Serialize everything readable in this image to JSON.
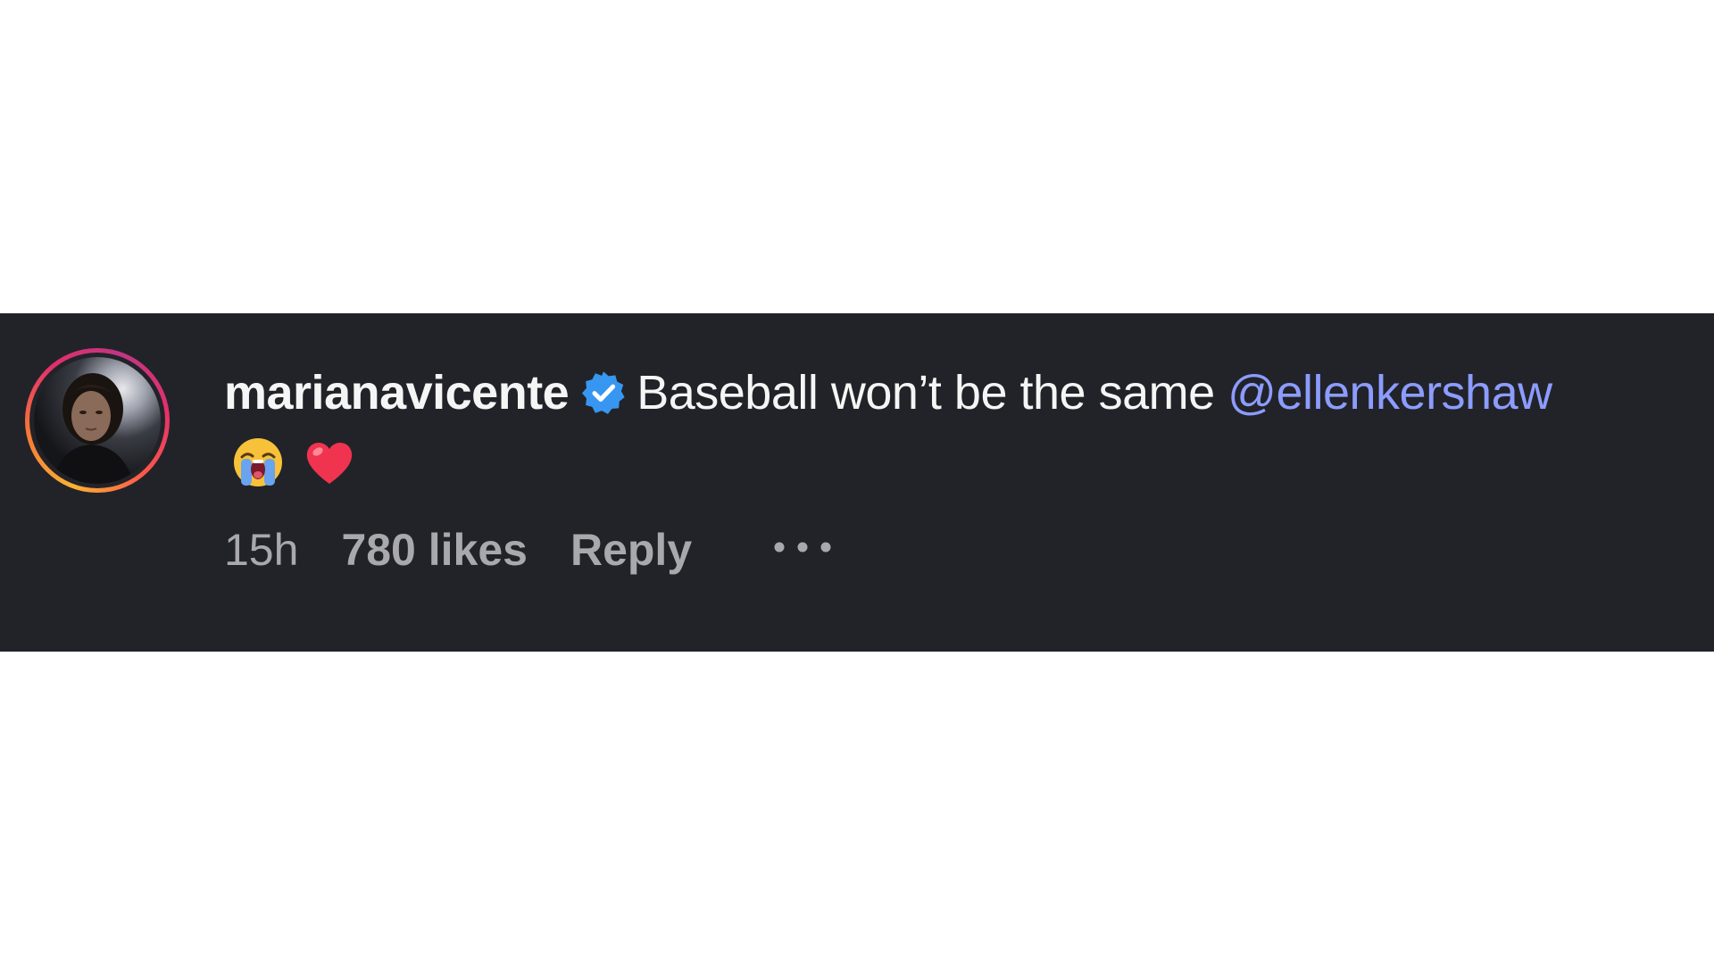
{
  "comment": {
    "username": "marianavicente",
    "verified_icon": "verified-badge-icon",
    "text": "Baseball won’t be the same ",
    "mention": "@ellenkershaw",
    "emojis": [
      "loudly-crying-face-icon",
      "red-heart-icon"
    ],
    "timestamp": "15h",
    "likes": "780 likes",
    "reply_label": "Reply",
    "more_icon": "more-options-icon"
  },
  "colors": {
    "background": "#222328",
    "text": "#f5f5f5",
    "meta": "#a8a8ad",
    "mention": "#8c9cff",
    "verified": "#3797f0"
  }
}
